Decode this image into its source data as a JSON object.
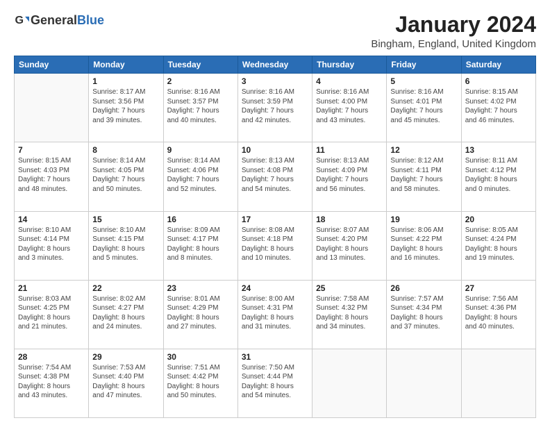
{
  "logo": {
    "general": "General",
    "blue": "Blue"
  },
  "title": "January 2024",
  "subtitle": "Bingham, England, United Kingdom",
  "calendar": {
    "headers": [
      "Sunday",
      "Monday",
      "Tuesday",
      "Wednesday",
      "Thursday",
      "Friday",
      "Saturday"
    ],
    "weeks": [
      [
        {
          "day": "",
          "sunrise": "",
          "sunset": "",
          "daylight": ""
        },
        {
          "day": "1",
          "sunrise": "Sunrise: 8:17 AM",
          "sunset": "Sunset: 3:56 PM",
          "daylight": "Daylight: 7 hours and 39 minutes."
        },
        {
          "day": "2",
          "sunrise": "Sunrise: 8:16 AM",
          "sunset": "Sunset: 3:57 PM",
          "daylight": "Daylight: 7 hours and 40 minutes."
        },
        {
          "day": "3",
          "sunrise": "Sunrise: 8:16 AM",
          "sunset": "Sunset: 3:59 PM",
          "daylight": "Daylight: 7 hours and 42 minutes."
        },
        {
          "day": "4",
          "sunrise": "Sunrise: 8:16 AM",
          "sunset": "Sunset: 4:00 PM",
          "daylight": "Daylight: 7 hours and 43 minutes."
        },
        {
          "day": "5",
          "sunrise": "Sunrise: 8:16 AM",
          "sunset": "Sunset: 4:01 PM",
          "daylight": "Daylight: 7 hours and 45 minutes."
        },
        {
          "day": "6",
          "sunrise": "Sunrise: 8:15 AM",
          "sunset": "Sunset: 4:02 PM",
          "daylight": "Daylight: 7 hours and 46 minutes."
        }
      ],
      [
        {
          "day": "7",
          "sunrise": "Sunrise: 8:15 AM",
          "sunset": "Sunset: 4:03 PM",
          "daylight": "Daylight: 7 hours and 48 minutes."
        },
        {
          "day": "8",
          "sunrise": "Sunrise: 8:14 AM",
          "sunset": "Sunset: 4:05 PM",
          "daylight": "Daylight: 7 hours and 50 minutes."
        },
        {
          "day": "9",
          "sunrise": "Sunrise: 8:14 AM",
          "sunset": "Sunset: 4:06 PM",
          "daylight": "Daylight: 7 hours and 52 minutes."
        },
        {
          "day": "10",
          "sunrise": "Sunrise: 8:13 AM",
          "sunset": "Sunset: 4:08 PM",
          "daylight": "Daylight: 7 hours and 54 minutes."
        },
        {
          "day": "11",
          "sunrise": "Sunrise: 8:13 AM",
          "sunset": "Sunset: 4:09 PM",
          "daylight": "Daylight: 7 hours and 56 minutes."
        },
        {
          "day": "12",
          "sunrise": "Sunrise: 8:12 AM",
          "sunset": "Sunset: 4:11 PM",
          "daylight": "Daylight: 7 hours and 58 minutes."
        },
        {
          "day": "13",
          "sunrise": "Sunrise: 8:11 AM",
          "sunset": "Sunset: 4:12 PM",
          "daylight": "Daylight: 8 hours and 0 minutes."
        }
      ],
      [
        {
          "day": "14",
          "sunrise": "Sunrise: 8:10 AM",
          "sunset": "Sunset: 4:14 PM",
          "daylight": "Daylight: 8 hours and 3 minutes."
        },
        {
          "day": "15",
          "sunrise": "Sunrise: 8:10 AM",
          "sunset": "Sunset: 4:15 PM",
          "daylight": "Daylight: 8 hours and 5 minutes."
        },
        {
          "day": "16",
          "sunrise": "Sunrise: 8:09 AM",
          "sunset": "Sunset: 4:17 PM",
          "daylight": "Daylight: 8 hours and 8 minutes."
        },
        {
          "day": "17",
          "sunrise": "Sunrise: 8:08 AM",
          "sunset": "Sunset: 4:18 PM",
          "daylight": "Daylight: 8 hours and 10 minutes."
        },
        {
          "day": "18",
          "sunrise": "Sunrise: 8:07 AM",
          "sunset": "Sunset: 4:20 PM",
          "daylight": "Daylight: 8 hours and 13 minutes."
        },
        {
          "day": "19",
          "sunrise": "Sunrise: 8:06 AM",
          "sunset": "Sunset: 4:22 PM",
          "daylight": "Daylight: 8 hours and 16 minutes."
        },
        {
          "day": "20",
          "sunrise": "Sunrise: 8:05 AM",
          "sunset": "Sunset: 4:24 PM",
          "daylight": "Daylight: 8 hours and 19 minutes."
        }
      ],
      [
        {
          "day": "21",
          "sunrise": "Sunrise: 8:03 AM",
          "sunset": "Sunset: 4:25 PM",
          "daylight": "Daylight: 8 hours and 21 minutes."
        },
        {
          "day": "22",
          "sunrise": "Sunrise: 8:02 AM",
          "sunset": "Sunset: 4:27 PM",
          "daylight": "Daylight: 8 hours and 24 minutes."
        },
        {
          "day": "23",
          "sunrise": "Sunrise: 8:01 AM",
          "sunset": "Sunset: 4:29 PM",
          "daylight": "Daylight: 8 hours and 27 minutes."
        },
        {
          "day": "24",
          "sunrise": "Sunrise: 8:00 AM",
          "sunset": "Sunset: 4:31 PM",
          "daylight": "Daylight: 8 hours and 31 minutes."
        },
        {
          "day": "25",
          "sunrise": "Sunrise: 7:58 AM",
          "sunset": "Sunset: 4:32 PM",
          "daylight": "Daylight: 8 hours and 34 minutes."
        },
        {
          "day": "26",
          "sunrise": "Sunrise: 7:57 AM",
          "sunset": "Sunset: 4:34 PM",
          "daylight": "Daylight: 8 hours and 37 minutes."
        },
        {
          "day": "27",
          "sunrise": "Sunrise: 7:56 AM",
          "sunset": "Sunset: 4:36 PM",
          "daylight": "Daylight: 8 hours and 40 minutes."
        }
      ],
      [
        {
          "day": "28",
          "sunrise": "Sunrise: 7:54 AM",
          "sunset": "Sunset: 4:38 PM",
          "daylight": "Daylight: 8 hours and 43 minutes."
        },
        {
          "day": "29",
          "sunrise": "Sunrise: 7:53 AM",
          "sunset": "Sunset: 4:40 PM",
          "daylight": "Daylight: 8 hours and 47 minutes."
        },
        {
          "day": "30",
          "sunrise": "Sunrise: 7:51 AM",
          "sunset": "Sunset: 4:42 PM",
          "daylight": "Daylight: 8 hours and 50 minutes."
        },
        {
          "day": "31",
          "sunrise": "Sunrise: 7:50 AM",
          "sunset": "Sunset: 4:44 PM",
          "daylight": "Daylight: 8 hours and 54 minutes."
        },
        {
          "day": "",
          "sunrise": "",
          "sunset": "",
          "daylight": ""
        },
        {
          "day": "",
          "sunrise": "",
          "sunset": "",
          "daylight": ""
        },
        {
          "day": "",
          "sunrise": "",
          "sunset": "",
          "daylight": ""
        }
      ]
    ]
  }
}
